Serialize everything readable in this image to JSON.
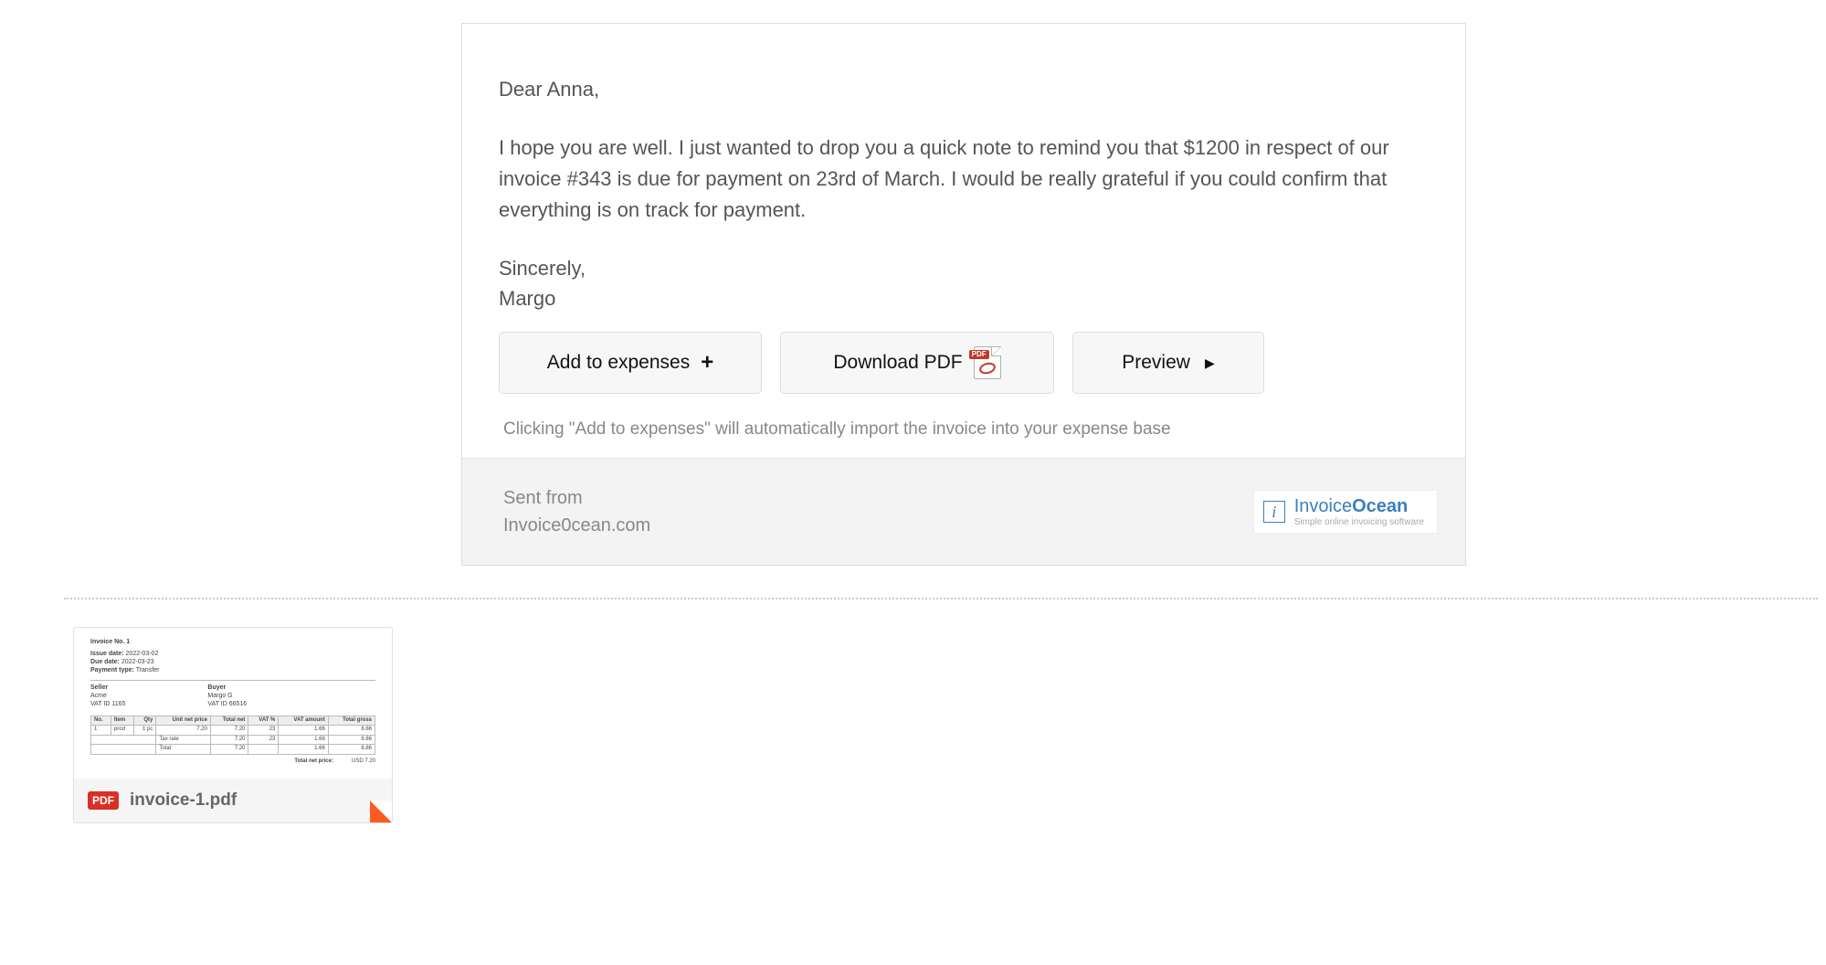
{
  "email": {
    "greeting": "Dear Anna,",
    "body": "I hope you are well. I just wanted to drop you a quick note to remind you that $1200 in respect of our invoice #343 is due for payment on 23rd of March. I would be really grateful if you could confirm that everything is on track for payment.",
    "closing": "Sincerely,",
    "sender": "Margo"
  },
  "buttons": {
    "add_expenses": "Add to expenses",
    "download_pdf": "Download PDF",
    "preview": "Preview",
    "pdf_badge": "PDF"
  },
  "hint": "Clicking \"Add to expenses\" will automatically import the invoice into your expense base",
  "footer": {
    "sent_from": "Sent from",
    "site": "Invoice0cean.com",
    "brand_a": "Invoice",
    "brand_b": "Ocean",
    "tagline": "Simple online invoicing software"
  },
  "attachment": {
    "filename": "invoice-1.pdf",
    "pdf_badge": "PDF",
    "thumb": {
      "title": "Invoice No. 1",
      "issue_label": "Issue date:",
      "issue_val": "2022-03-02",
      "due_label": "Due date:",
      "due_val": "2022-03-23",
      "pay_label": "Payment type:",
      "pay_val": "Transfer",
      "seller_h": "Seller",
      "seller_name": "Acme",
      "seller_vat": "VAT ID 1165",
      "buyer_h": "Buyer",
      "buyer_name": "Margo G",
      "buyer_vat": "VAT ID 66516",
      "cols": {
        "no": "No.",
        "item": "Item",
        "qty": "Qty",
        "unit": "Unit net price",
        "net": "Total net",
        "vatp": "VAT %",
        "vata": "VAT amount",
        "gross": "Total gross"
      },
      "row": {
        "no": "1",
        "item": "prod",
        "qty": "1 pc",
        "unit": "7.20",
        "net": "7.20",
        "vatp": "23",
        "vata": "1.66",
        "gross": "8.86"
      },
      "tax": {
        "lab": "Tax rate",
        "unit": "7.20",
        "net": "7.20",
        "vatp": "23",
        "vata": "1.66",
        "gross": "8.86"
      },
      "tot": {
        "lab": "Total",
        "unit": "7.20",
        "net": "7.20",
        "vatp": "",
        "vata": "1.66",
        "gross": "8.86"
      },
      "total_label": "Total net price:",
      "total_value": "USD 7.20"
    }
  }
}
